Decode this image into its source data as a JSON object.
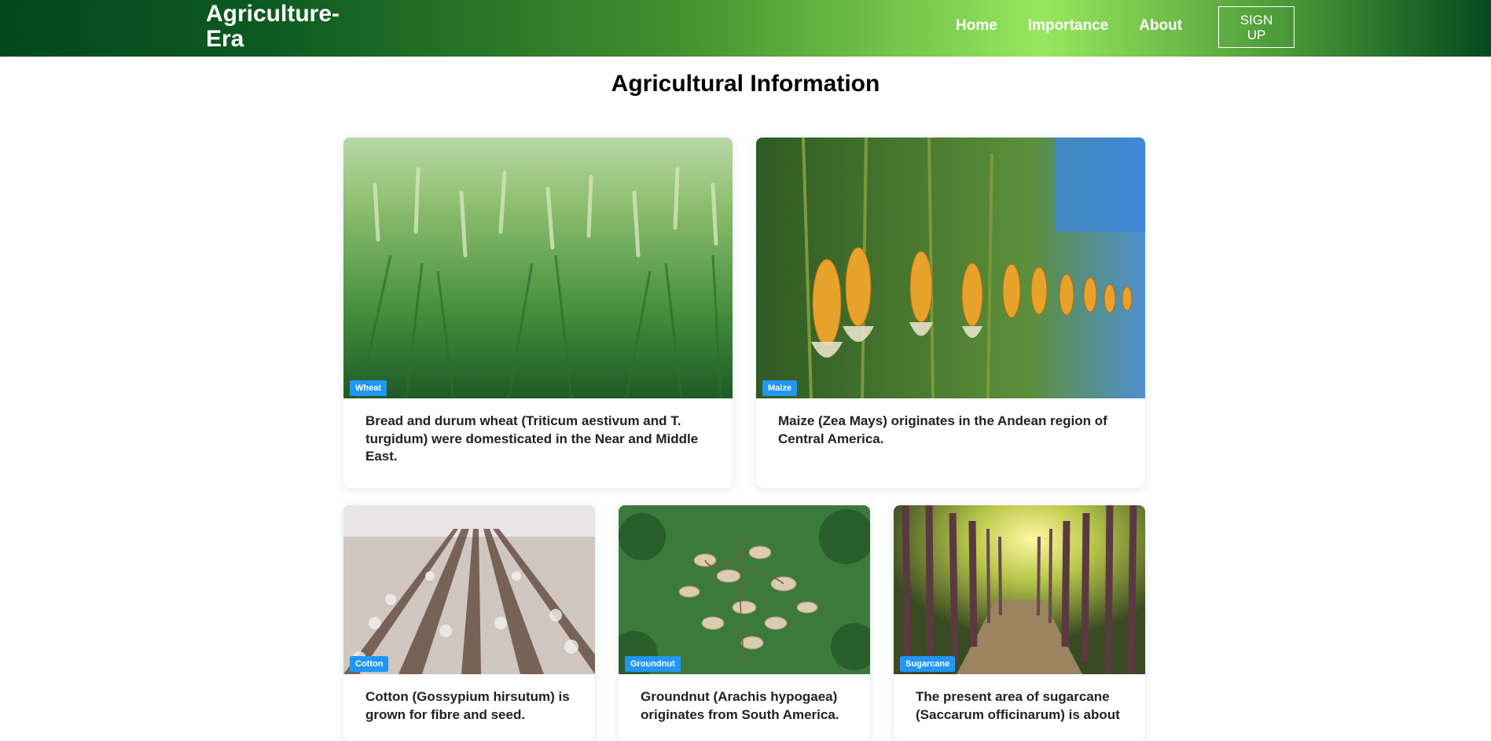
{
  "brand": "Agriculture-\nEra",
  "nav": {
    "home": "Home",
    "importance": "Importance",
    "about": "About",
    "signup": "SIGN UP"
  },
  "page_title": "Agricultural Information",
  "cards": [
    {
      "tag": "Wheat",
      "text": "Bread and durum wheat (Triticum aestivum and T. turgidum) were domesticated in the Near and Middle East.",
      "image": "wheat-field"
    },
    {
      "tag": "Maize",
      "text": "Maize (Zea Mays) originates in the Andean region of Central America.",
      "image": "maize-field"
    },
    {
      "tag": "Cotton",
      "text": "Cotton (Gossypium hirsutum) is grown for fibre and seed.",
      "image": "cotton-field"
    },
    {
      "tag": "Groundnut",
      "text": "Groundnut (Arachis hypogaea) originates from South America.",
      "image": "groundnut-plant"
    },
    {
      "tag": "Sugarcane",
      "text": "The present area of sugarcane (Saccarum officinarum) is about",
      "image": "sugarcane-field"
    }
  ],
  "colors": {
    "nav_dark": "#00471e",
    "nav_light": "#98e65e",
    "tag": "#2196f3"
  }
}
